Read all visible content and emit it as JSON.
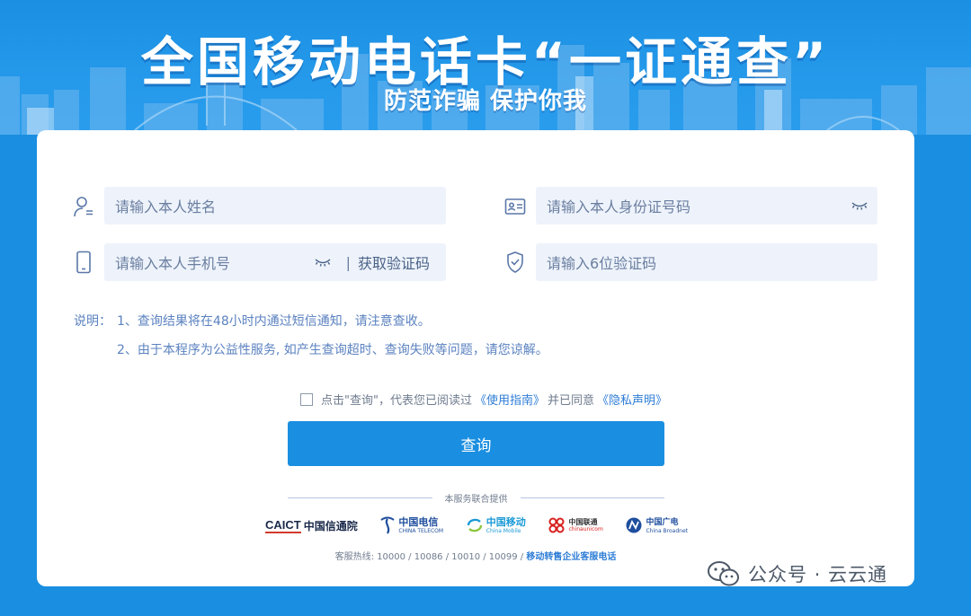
{
  "banner": {
    "title": "全国移动电话卡“一证通查”",
    "subtitle": "防范诈骗 保护你我"
  },
  "form": {
    "name_placeholder": "请输入本人姓名",
    "id_placeholder": "请输入本人身份证号码",
    "phone_placeholder": "请输入本人手机号",
    "separator": "|",
    "get_code_label": "获取验证码",
    "code_placeholder": "请输入6位验证码"
  },
  "notes": {
    "label": "说明：",
    "items": [
      "1、查询结果将在48小时内通过短信通知，请注意查收。",
      "2、由于本程序为公益性服务, 如产生查询超时、查询失败等问题，请您谅解。"
    ]
  },
  "agreement": {
    "text_before": "点击\"查询\"，代表您已阅读过",
    "guide_link": "《使用指南》",
    "text_middle": "并已同意",
    "privacy_link": "《隐私声明》",
    "checked": false
  },
  "query_button": "查询",
  "provided_by": "本服务联合提供",
  "logos": {
    "caict_en": "CAICT",
    "caict_cn": "中国信通院",
    "telecom_cn": "中国电信",
    "telecom_en": "CHINA TELECOM",
    "mobile_cn": "中国移动",
    "mobile_en": "China Mobile",
    "unicom_cn": "中国联通",
    "unicom_en": "chinaunicom",
    "broadnet_cn": "中国广电",
    "broadnet_en": "China Broadnet"
  },
  "hotline": {
    "text": "客服热线: 10000 / 10086 / 10010 / 10099 /",
    "link": "移动转售企业客服电话"
  },
  "watermark": "公众号 · 云云通",
  "colors": {
    "brand_blue": "#1a8ee0",
    "link_blue": "#2e7dd6",
    "field_bg": "#eef3fb"
  },
  "icons": {
    "name": "user-icon",
    "id": "id-card-icon",
    "phone": "mobile-phone-icon",
    "code": "shield-check-icon",
    "visibility": "eye-closed-icon"
  }
}
